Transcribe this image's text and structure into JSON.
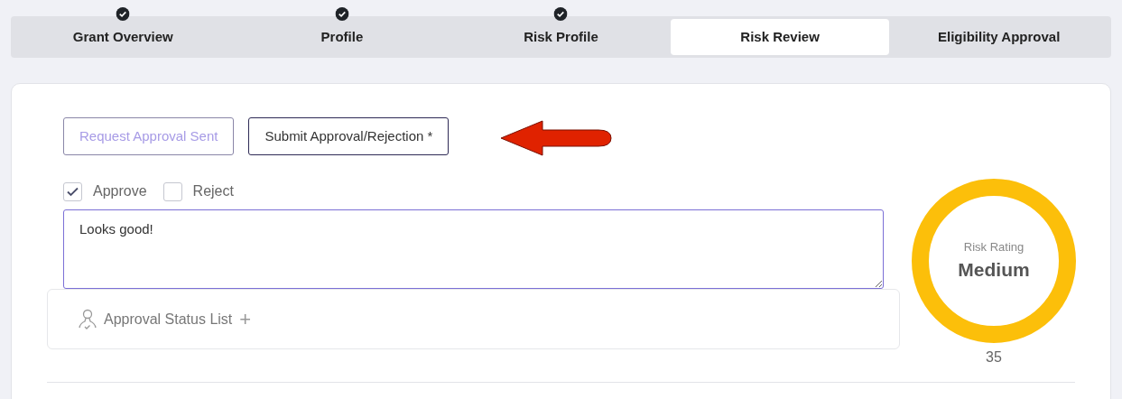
{
  "steps": [
    {
      "label": "Grant Overview",
      "completed": true,
      "selected": false
    },
    {
      "label": "Profile",
      "completed": true,
      "selected": false
    },
    {
      "label": "Risk Profile",
      "completed": true,
      "selected": false
    },
    {
      "label": "Risk Review",
      "completed": false,
      "selected": true
    },
    {
      "label": "Eligibility Approval",
      "completed": false,
      "selected": false
    }
  ],
  "actions": [
    {
      "label": "Request Approval Sent",
      "disabled": true
    },
    {
      "label": "Submit Approval/Rejection *",
      "disabled": false
    }
  ],
  "decision": [
    {
      "label": "Approve",
      "checked": true
    },
    {
      "label": "Reject",
      "checked": false
    }
  ],
  "comment": {
    "value": "Looks good!"
  },
  "approval_status": {
    "label": "Approval Status List",
    "plus": "+"
  },
  "risk": {
    "title": "Risk Rating",
    "rating": "Medium",
    "score": "35"
  }
}
